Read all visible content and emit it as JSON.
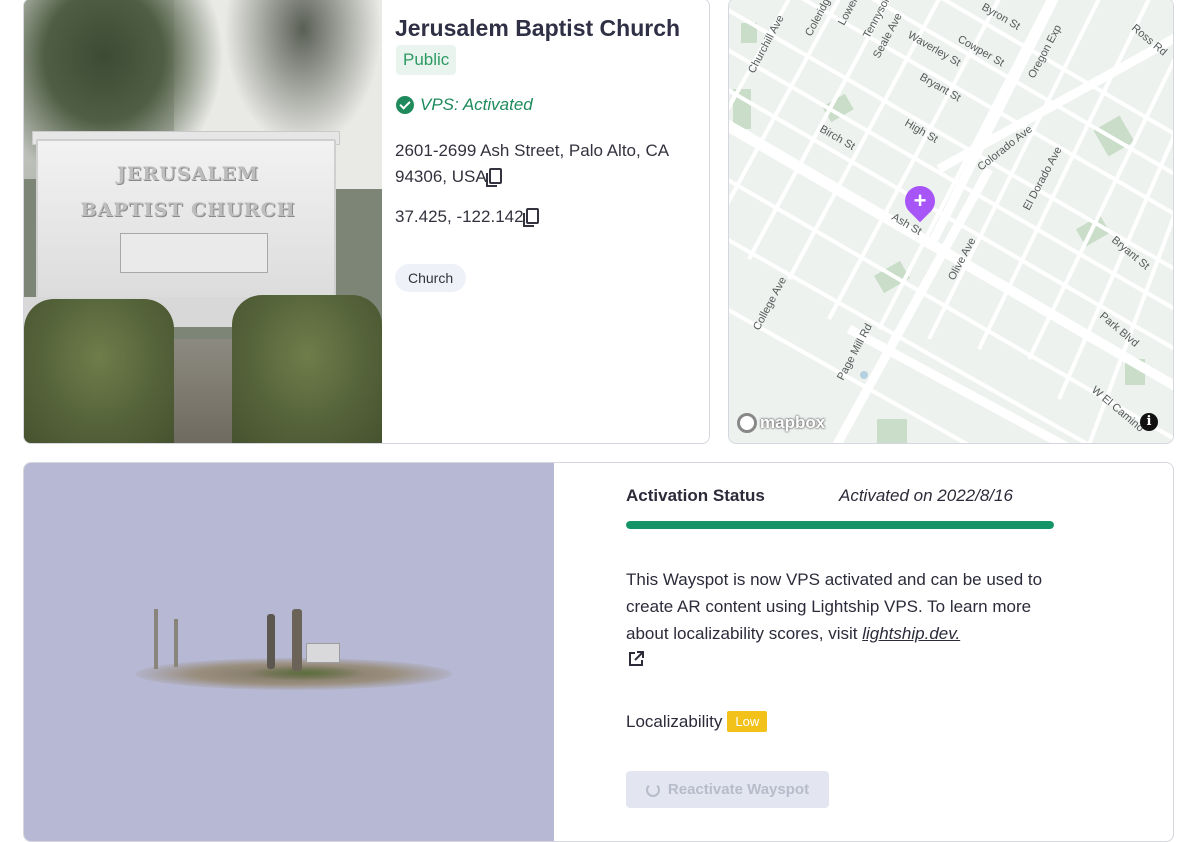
{
  "place": {
    "name": "Jerusalem Baptist Church",
    "visibility": "Public",
    "vps_status": "VPS: Activated",
    "address": "2601-2699 Ash Street, Palo Alto, CA 94306, USA",
    "coordinates": "37.425, -122.142",
    "category": "Church"
  },
  "photo": {
    "sign_line1": "JERUSALEM",
    "sign_line2": "BAPTIST CHURCH"
  },
  "map": {
    "attribution": "mapbox",
    "info": "i",
    "pin_symbol": "+",
    "street_labels": [
      "Churchill Ave",
      "Coleridge",
      "Lowell",
      "Tennyson",
      "Seale Ave",
      "Waverley St",
      "Bryant St",
      "Byron St",
      "Cowper St",
      "Oregon Exp",
      "Ross Rd",
      "Birch St",
      "High St",
      "Colorado Ave",
      "El Dorado Ave",
      "Ash St",
      "Olive Ave",
      "College Ave",
      "Page Mill Rd",
      "Bryant St",
      "Park Blvd",
      "W El Camino"
    ]
  },
  "activation": {
    "label": "Activation Status",
    "date_text": "Activated on 2022/8/16",
    "progress": 1.0,
    "description_text": "This Wayspot is now VPS activated and can be used to create AR content using Lightship VPS. To learn more about localizability scores, visit ",
    "link_text": "lightship.dev.",
    "localizability_label": "Localizability",
    "localizability_value": "Low",
    "reactivate_label": "Reactivate Wayspot"
  },
  "colors": {
    "accent_green": "#149467",
    "public_badge_bg": "#eaf4ee",
    "pin": "#a855f7",
    "low_badge": "#f2c21b"
  }
}
